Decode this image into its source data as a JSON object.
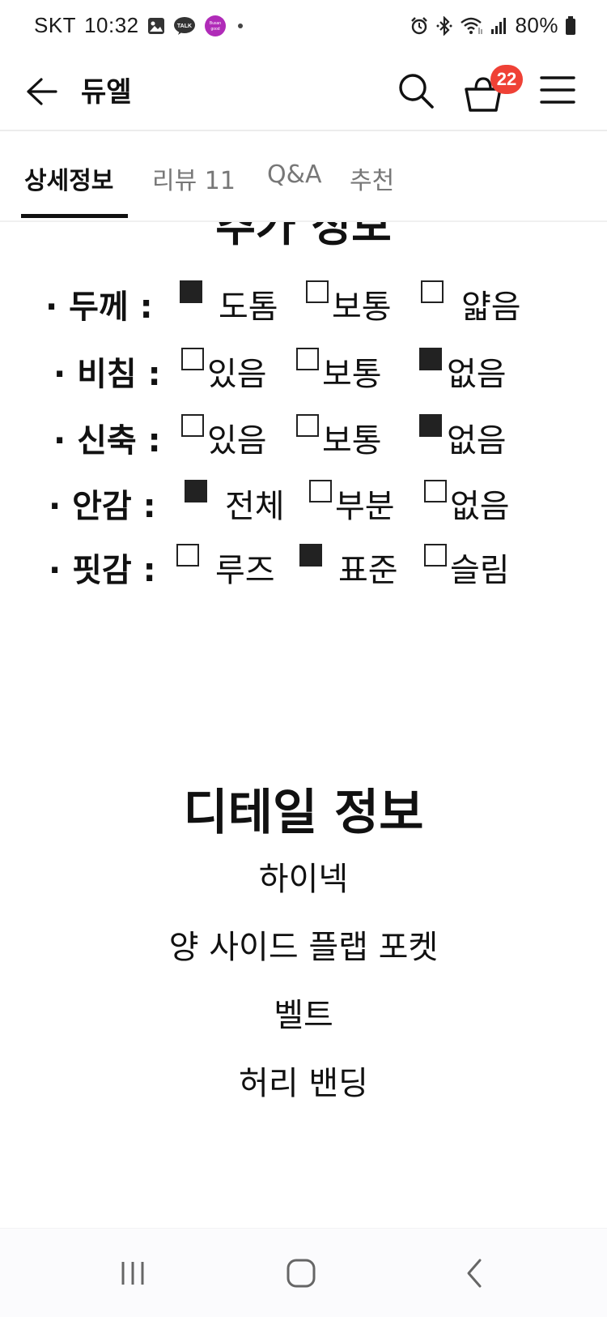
{
  "status_bar": {
    "carrier": "SKT",
    "time": "10:32",
    "notif_busan_label": "Busan is good",
    "notif_talk_label": "TALK",
    "battery": "80%"
  },
  "header": {
    "title": "듀엘",
    "cart_count": "22"
  },
  "tabs": [
    {
      "label": "상세정보"
    },
    {
      "label": "리뷰 11"
    },
    {
      "label": "Q&A"
    },
    {
      "label": "추천"
    }
  ],
  "extra_info": {
    "title": "추가 정보",
    "rows": [
      {
        "label": "· 두께 :",
        "options": [
          {
            "text": "도톰",
            "checked": true
          },
          {
            "text": "보통",
            "checked": false
          },
          {
            "text": "얇음",
            "checked": false
          }
        ]
      },
      {
        "label": "· 비침 :",
        "options": [
          {
            "text": "있음",
            "checked": false
          },
          {
            "text": "보통",
            "checked": false
          },
          {
            "text": "없음",
            "checked": true
          }
        ]
      },
      {
        "label": "· 신축 :",
        "options": [
          {
            "text": "있음",
            "checked": false
          },
          {
            "text": "보통",
            "checked": false
          },
          {
            "text": "없음",
            "checked": true
          }
        ]
      },
      {
        "label": "· 안감 :",
        "options": [
          {
            "text": "전체",
            "checked": true
          },
          {
            "text": "부분",
            "checked": false
          },
          {
            "text": "없음",
            "checked": false
          }
        ]
      },
      {
        "label": "· 핏감 :",
        "options": [
          {
            "text": "루즈",
            "checked": false
          },
          {
            "text": "표준",
            "checked": true
          },
          {
            "text": "슬림",
            "checked": false
          }
        ]
      }
    ]
  },
  "detail_info": {
    "title": "디테일 정보",
    "items": [
      "하이넥",
      "양 사이드 플랩 포켓",
      "벨트",
      "허리 밴딩"
    ]
  },
  "colors": {
    "badge": "#ef4136",
    "tab_active": "#111111",
    "tab_inactive": "#777777"
  },
  "icons": {
    "back": "arrow-left-icon",
    "search": "search-icon",
    "cart": "shopping-basket-icon",
    "menu": "hamburger-menu-icon",
    "nav_recent": "recent-apps-icon",
    "nav_home": "home-icon",
    "nav_back": "chevron-left-icon"
  }
}
